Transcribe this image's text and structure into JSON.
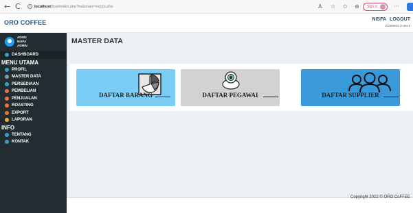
{
  "browser": {
    "back": "←",
    "reload": "C",
    "info": "i",
    "url_host": "localhost",
    "url_path": "/kopi/index.php?halaman=mdata.php",
    "signin": "Sign in",
    "more": "···"
  },
  "header": {
    "brand": "ORO COFFEE",
    "user": "NISFA",
    "logout": "LOGOUT",
    "datetime": "2023/06/24 17:49:15"
  },
  "sidebar": {
    "user": [
      "AD001",
      "NISFA",
      "ADMIN"
    ],
    "dashboard": "DASHBOARD",
    "section_main": "MENU UTAMA",
    "items": [
      {
        "label": "PROFIL",
        "color": "#3aa0c9"
      },
      {
        "label": "MASTER DATA",
        "color": "#8a9aa5"
      },
      {
        "label": "PERSEDIAAN",
        "color": "#3aa0c9"
      },
      {
        "label": "PEMBELIAN",
        "color": "#e9743c"
      },
      {
        "label": "PENJUALAN",
        "color": "#e9743c"
      },
      {
        "label": "ROASTING",
        "color": "#e9743c"
      },
      {
        "label": "EXPORT",
        "color": "#e9743c"
      },
      {
        "label": "LAPORAN",
        "color": "#e8b23a"
      }
    ],
    "section_info": "INFO",
    "info_items": [
      {
        "label": "TENTANG",
        "color": "#3aa0c9"
      },
      {
        "label": "KONTAK",
        "color": "#3aa0c9"
      }
    ]
  },
  "main": {
    "title": "MASTER DATA",
    "cards": [
      {
        "label": "DAFTAR BARANG",
        "color": "#7ccdf5",
        "icon": "pie-chart-icon"
      },
      {
        "label": "DAFTAR PEGAWAI",
        "color": "#d2d2d2",
        "icon": "employee-icon"
      },
      {
        "label": "DAFTAR SUPPLIER",
        "color": "#3a9ad9",
        "icon": "group-icon"
      }
    ],
    "copyright": "Copyright 2022 © ORO CoFFEE"
  }
}
